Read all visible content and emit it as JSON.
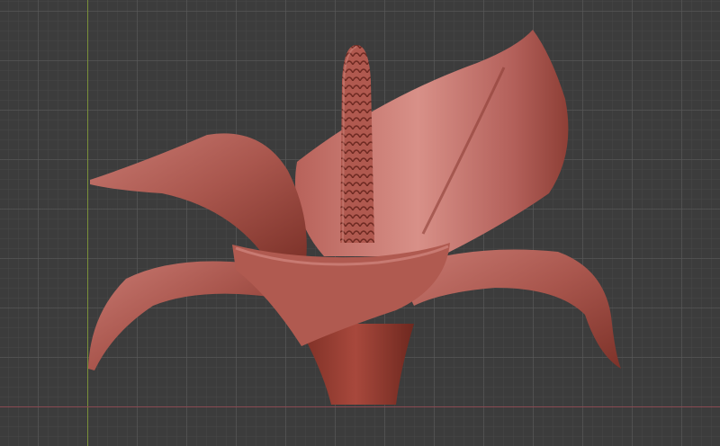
{
  "viewport": {
    "object": "sculpted-flower",
    "colors": {
      "background": "#3c3c3c",
      "x_axis": "#8a4a52",
      "y_axis": "#7a8f3a",
      "clay_light": "#c9756e",
      "clay_mid": "#a8544c",
      "clay_dark": "#7a3028"
    }
  }
}
